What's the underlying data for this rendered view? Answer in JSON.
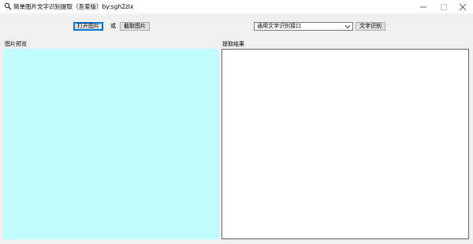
{
  "window": {
    "title": "简单图片文字识别提取（吾爱版）by:sgh2zlx",
    "icon": "magnifier-icon",
    "controls": [
      "minimize-icon",
      "maximize-icon",
      "close-icon"
    ]
  },
  "toolbar": {
    "open_image_label": "打开图片",
    "or_label": "或",
    "capture_label": "截取图片",
    "api_select_value": "通用文字识别接口",
    "recognize_label": "文字识别"
  },
  "panels": {
    "preview_label": "图片预览",
    "preview_bg": "#c0fcfc",
    "result_label": "提取结果",
    "result_text": ""
  }
}
